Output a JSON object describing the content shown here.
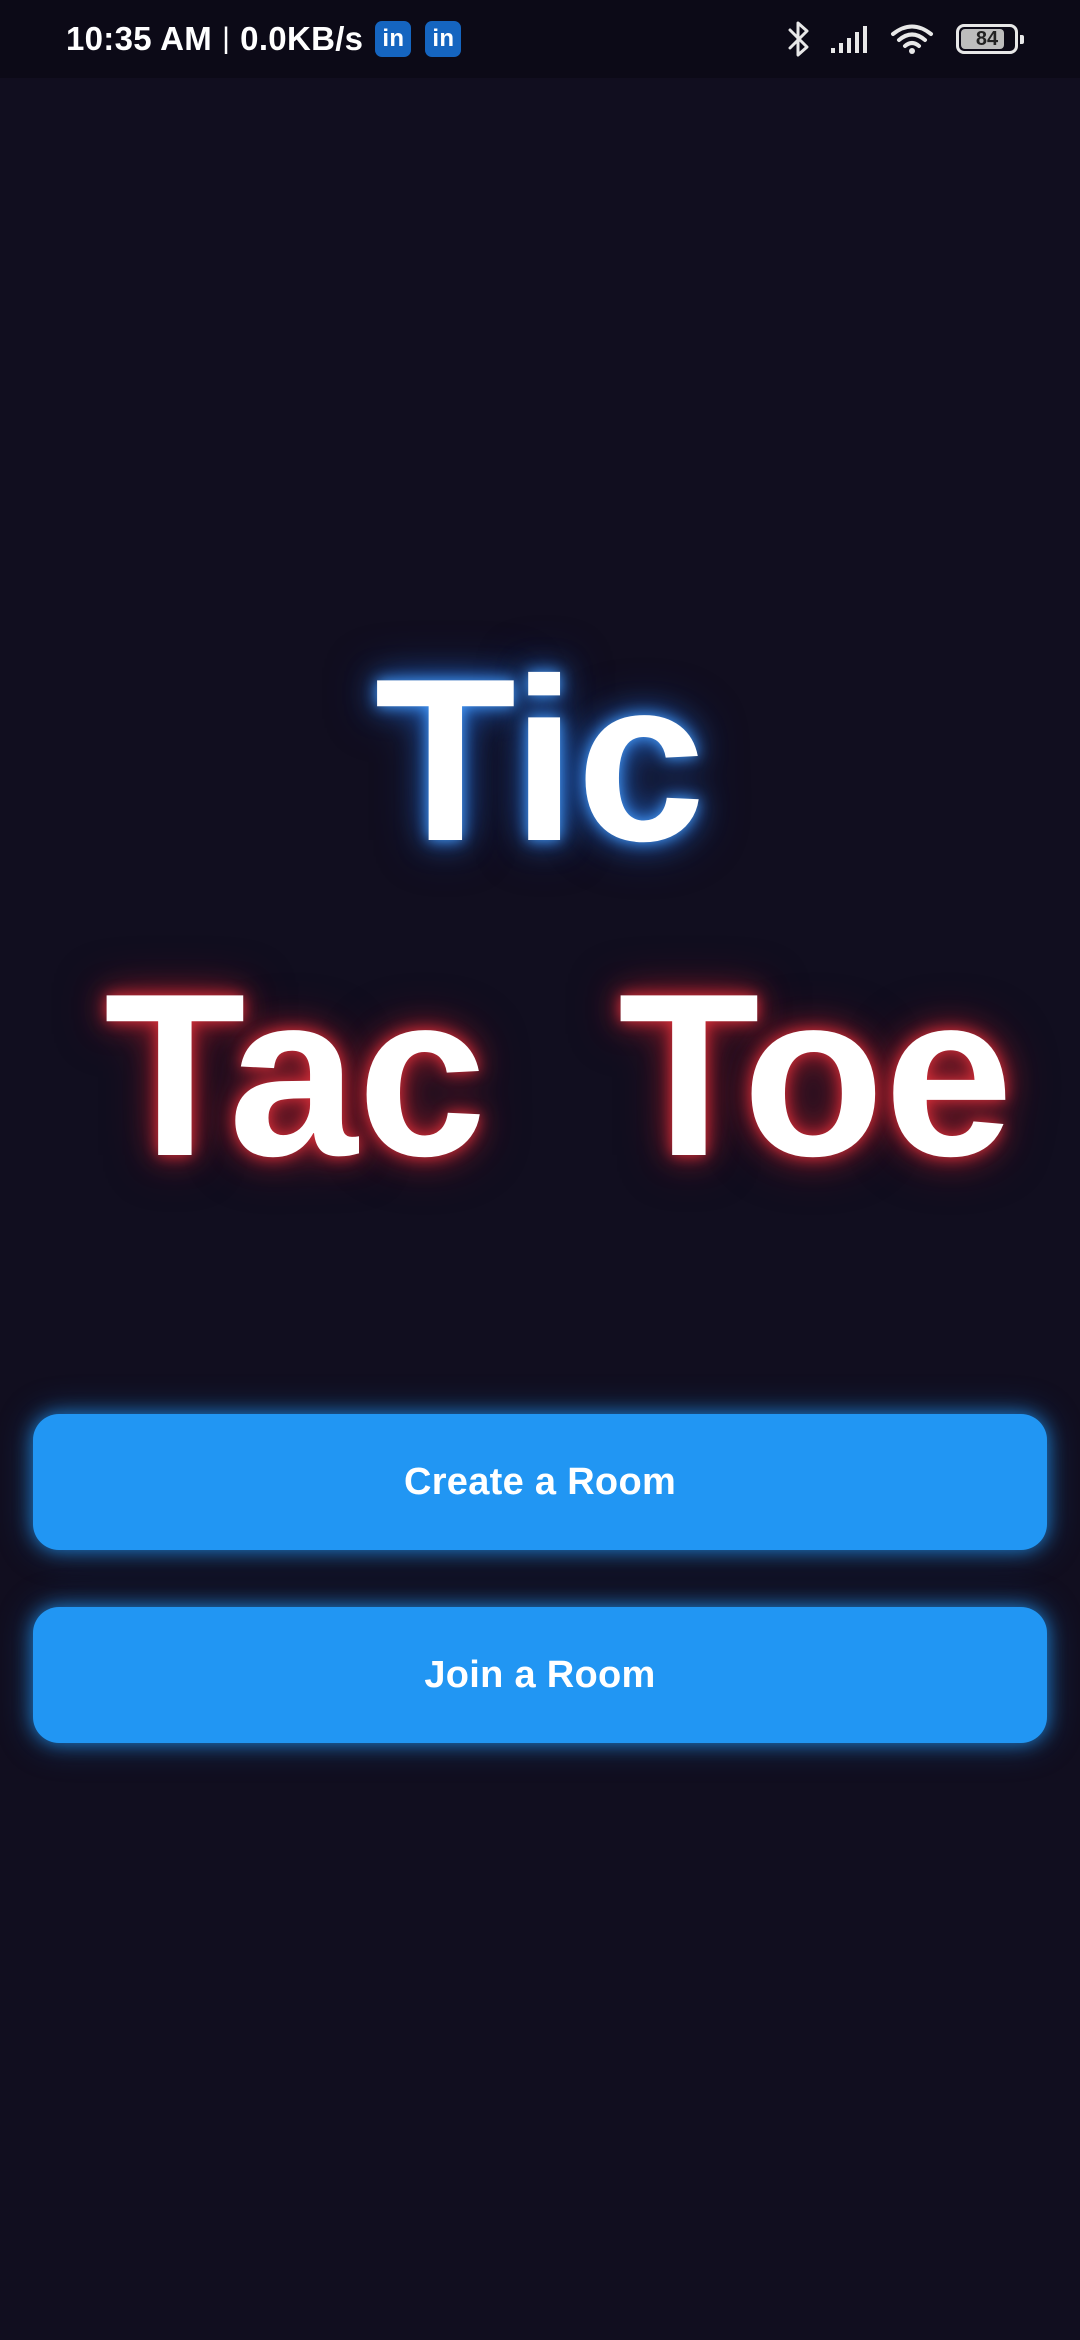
{
  "status_bar": {
    "time": "10:35 AM",
    "separator": "|",
    "network_speed": "0.0KB/s",
    "notification_icons": [
      "linkedin-icon",
      "linkedin-icon"
    ],
    "notification_icon_text": "in",
    "right_icons": [
      "bluetooth-icon",
      "signal-icon",
      "wifi-icon",
      "battery-icon"
    ],
    "battery_level": "84"
  },
  "title": {
    "line1": "Tic",
    "line2_left": "Tac",
    "line2_right": "Toe",
    "glow_colors": {
      "tic": "#2f8cff",
      "tac_toe": "#d12c38"
    }
  },
  "actions": {
    "create_room_label": "Create a Room",
    "join_room_label": "Join a Room"
  },
  "colors": {
    "background": "#110e1f",
    "button": "#2196f3",
    "text": "#ffffff"
  }
}
